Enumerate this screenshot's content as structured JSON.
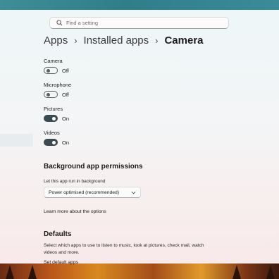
{
  "search": {
    "placeholder": "Find a setting"
  },
  "breadcrumb": {
    "items": [
      "Apps",
      "Installed apps"
    ],
    "current": "Camera"
  },
  "permissions": [
    {
      "label": "Camera",
      "state": "Off",
      "on": false
    },
    {
      "label": "Microphone",
      "state": "Off",
      "on": false
    },
    {
      "label": "Pictures",
      "state": "On",
      "on": true
    },
    {
      "label": "Videos",
      "state": "On",
      "on": true
    }
  ],
  "background": {
    "heading": "Background app permissions",
    "run_label": "Let this app run in background",
    "dropdown_value": "Power optimised (recommended)",
    "learn_more": "Learn more about the options"
  },
  "defaults": {
    "heading": "Defaults",
    "description": "Select which apps to use to listen to music, look at pictures, check mail, watch videos and more.",
    "link": "Set default apps"
  },
  "colors": {
    "toggle_on": "#3a4a52",
    "toggle_off_border": "#5d5f61"
  },
  "icons": {
    "search": "search-icon",
    "breadcrumb_sep": "chevron-right-icon",
    "dropdown": "chevron-down-icon"
  }
}
